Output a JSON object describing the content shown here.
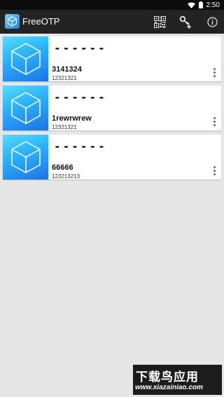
{
  "status_bar": {
    "time": "2:50"
  },
  "app_bar": {
    "title": "FreeOTP",
    "icons": [
      "qr-code-icon",
      "key-add-icon",
      "info-icon"
    ]
  },
  "tokens": [
    {
      "code": "------",
      "issuer": "3141324",
      "label": "12321321"
    },
    {
      "code": "------",
      "issuer": "1rewrwrew",
      "label": "12321321"
    },
    {
      "code": "------",
      "issuer": "66666",
      "label": "123213213"
    }
  ],
  "watermark": {
    "title": "下载鸟应用",
    "url": "www.xiazainiao.com"
  },
  "colors": {
    "status_bar": "#0c0c0c",
    "app_bar": "#232323",
    "background": "#e6e6e6",
    "card": "#ffffff",
    "token_image_top": "#53dcff",
    "token_image_bottom": "#1a73e8"
  }
}
